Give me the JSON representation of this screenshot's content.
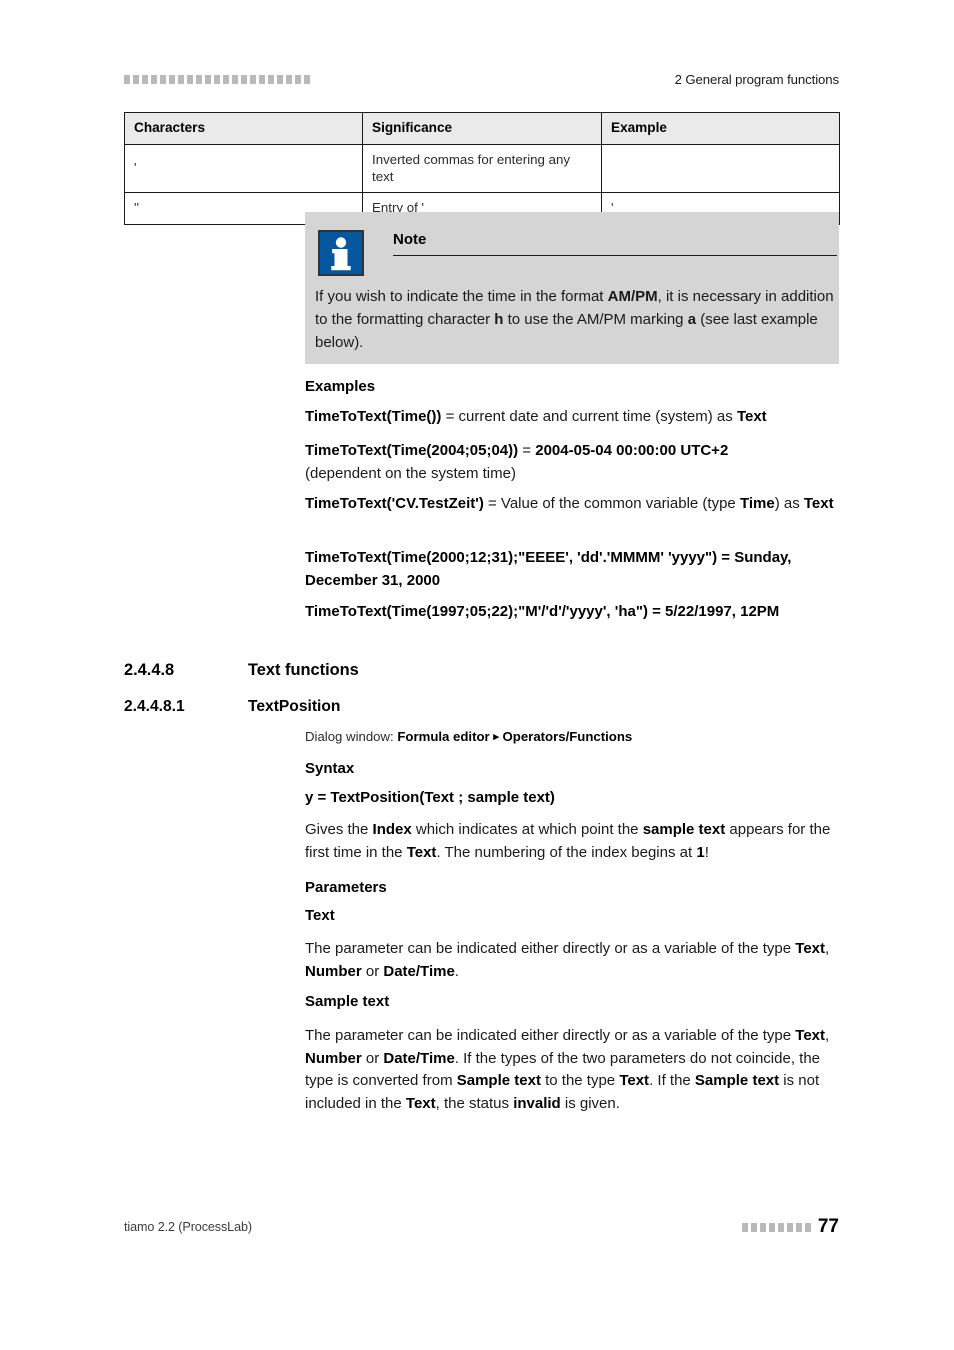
{
  "header": {
    "decor_squares": 21,
    "title": "2 General program functions"
  },
  "table": {
    "columns": [
      "Characters",
      "Significance",
      "Example"
    ],
    "rows": [
      {
        "characters": "'",
        "significance": "Inverted commas for entering any text",
        "example": ""
      },
      {
        "characters": "''",
        "significance": "Entry of '",
        "example": "'"
      }
    ]
  },
  "note": {
    "icon": "info-icon",
    "title": "Note",
    "body_html": "If you wish to indicate the time in the format <b>AM/PM</b>, it is necessary in addition to the formatting character <b>h</b> to use the AM/PM marking <b>a</b> (see last example below).",
    "background_color": "#d5d5d5",
    "icon_color": "#05579e"
  },
  "examples": {
    "heading": "Examples",
    "items": [
      {
        "html": "<b>TimeToText(Time())</b> = current date and current time (system) as <b>Text</b>"
      },
      {
        "html": "<b>TimeToText(Time(2004;05;04))</b> = <b>2004-05-04 00:00:00 UTC+2</b><br>(dependent on the system time)"
      },
      {
        "html": "<b>TimeToText('CV.TestZeit')</b> = Value of the common variable (type <b>Time</b>) as <b>Text</b>"
      },
      {
        "html": "<b>TimeToText(Time(2000;12;31);\"EEEE', 'dd'.'MMMM' 'yyyy\") = Sunday, December 31, 2000</b>"
      },
      {
        "html": "<b>TimeToText(Time(1997;05;22);\"M'/'d'/'yyyy', 'ha\") = 5/22/1997, 12PM</b>"
      }
    ]
  },
  "sections": [
    {
      "number": "2.4.4.8",
      "title": "Text functions",
      "level": "h3"
    },
    {
      "number": "2.4.4.8.1",
      "title": "TextPosition",
      "level": "h4"
    }
  ],
  "dialog_window": {
    "label": "Dialog window:",
    "path": [
      "Formula editor",
      "Operators/Functions"
    ],
    "separator_icon": "triangle-right-icon",
    "html": "Dialog window: <b>Formula editor <span class=\"arrow-glyph\">&#9656;</span> Operators/Functions</b>"
  },
  "syntax": {
    "heading": "Syntax",
    "signature": "y = TextPosition(Text ; sample text)",
    "description_html": "Gives the <b>Index</b> which indicates at which point the <b>sample text</b> appears for the first time in the <b>Text</b>. The numbering of the index begins at <b>1</b>!"
  },
  "parameters": {
    "heading": "Parameters",
    "entries": [
      {
        "name": "Text",
        "description_html": "The parameter can be indicated either directly or as a variable of the type <b>Text</b>, <b>Number</b> or <b>Date/Time</b>."
      },
      {
        "name": "Sample text",
        "description_html": "The parameter can be indicated either directly or as a variable of the type <b>Text</b>, <b>Number</b> or <b>Date/Time</b>. If the types of the two parameters do not coincide, the type is converted from <b>Sample text</b> to the type <b>Text</b>. If the <b>Sample text</b> is not included in the <b>Text</b>, the status <b>invalid</b> is given."
      }
    ]
  },
  "footer": {
    "product": "tiamo 2.2 (ProcessLab)",
    "decor_squares": 8,
    "page_number": "77"
  }
}
